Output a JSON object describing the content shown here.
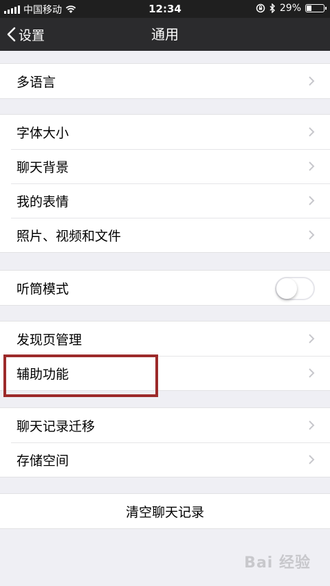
{
  "status": {
    "carrier": "中国移动",
    "time": "12:34",
    "battery": "29%",
    "battery_level": 0.29
  },
  "nav": {
    "back_label": "设置",
    "title": "通用"
  },
  "groups": [
    {
      "items": [
        {
          "label": "多语言"
        }
      ]
    },
    {
      "items": [
        {
          "label": "字体大小"
        },
        {
          "label": "聊天背景"
        },
        {
          "label": "我的表情"
        },
        {
          "label": "照片、视频和文件"
        }
      ]
    },
    {
      "items": [
        {
          "label": "听筒模式",
          "toggle_on": false
        }
      ]
    },
    {
      "items": [
        {
          "label": "发现页管理"
        },
        {
          "label": "辅助功能"
        }
      ]
    },
    {
      "items": [
        {
          "label": "聊天记录迁移"
        },
        {
          "label": "存储空间"
        }
      ]
    },
    {
      "items": [
        {
          "label": "清空聊天记录"
        }
      ]
    }
  ],
  "watermark": "Bai 经验",
  "colors": {
    "nav_bg": "#2b2b2d",
    "page_bg": "#efeff4",
    "highlight": "#9c2a2a"
  }
}
